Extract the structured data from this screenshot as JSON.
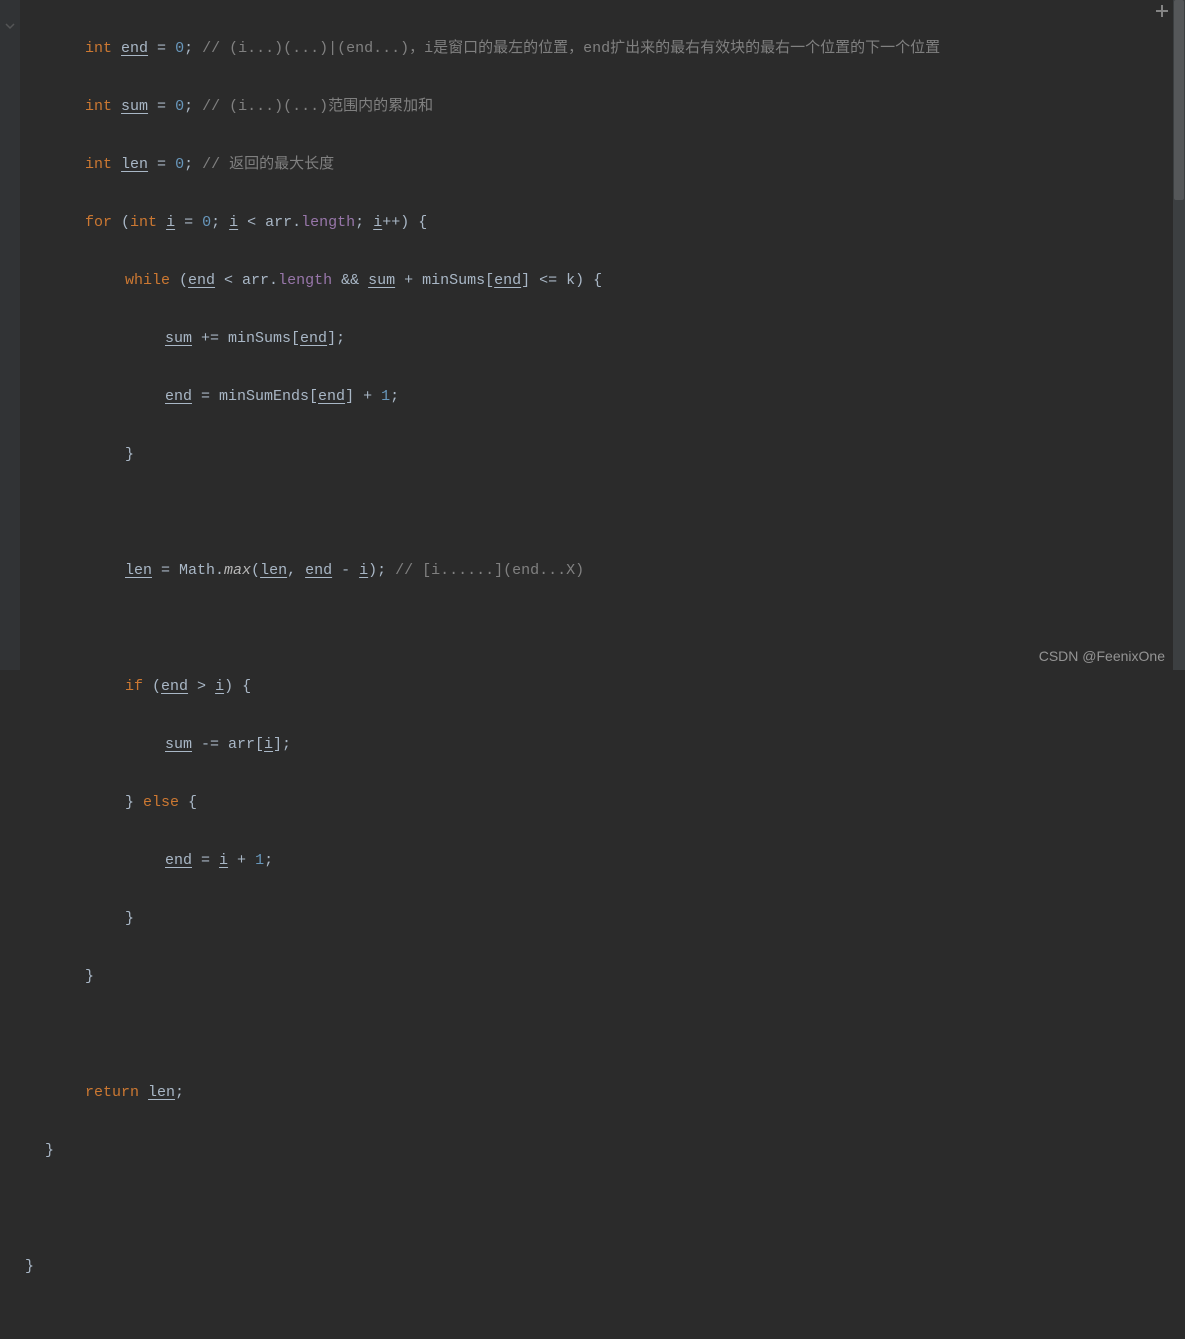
{
  "watermark": "CSDN @FeenixOne",
  "code": {
    "l1_int": "int",
    "l1_end": "end",
    "l1_eq": " = ",
    "l1_zero": "0",
    "l1_semi": "; ",
    "l1_comment": "// (i...)(...)|(end...)，i是窗口的最左的位置，end扩出来的最右有效块的最右一个位置的下一个位置",
    "l2_sum": "sum",
    "l2_comment": "// (i...)(...)范围内的累加和",
    "l3_len": "len",
    "l3_comment": "// 返回的最大长度",
    "l4_for": "for",
    "l4_lparen": " (",
    "l4_int": "int",
    "l4_i": "i",
    "l4_eq": " = ",
    "l4_zero": "0",
    "l4_semi1": "; ",
    "l4_lt": " < arr.",
    "l4_length": "length",
    "l4_semi2": "; ",
    "l4_inc": "++",
    "l4_rparen": ") {",
    "l5_while": "while",
    "l5_lparen": " (",
    "l5_lt": " < arr.",
    "l5_and": " && ",
    "l5_plus": " + minSums[",
    "l5_le": "] <= k) {",
    "l6_pluseq": " += minSums[",
    "l6_close": "];",
    "l7_eq": " = minSumEnds[",
    "l7_plus": "] + ",
    "l7_one": "1",
    "l7_semi": ";",
    "l8_brace": "}",
    "l10_len": "len",
    "l10_eq": " = Math.",
    "l10_max": "max",
    "l10_lparen": "(",
    "l10_comma": ", ",
    "l10_minus": " - ",
    "l10_rparen": "); ",
    "l10_comment": "// [i......](end...X)",
    "l12_if": "if",
    "l12_lparen": " (",
    "l12_gt": " > ",
    "l12_rparen": ") {",
    "l13_minuseq": " -= arr[",
    "l13_close": "];",
    "l14_brace": "} ",
    "l14_else": "else",
    "l14_open": " {",
    "l15_eq": " = ",
    "l15_plus": " + ",
    "l16_brace": "}",
    "l17_brace": "}",
    "l19_return": "return",
    "l19_sp": " ",
    "l19_semi": ";",
    "l20_brace": "}",
    "l22_brace": "}"
  }
}
